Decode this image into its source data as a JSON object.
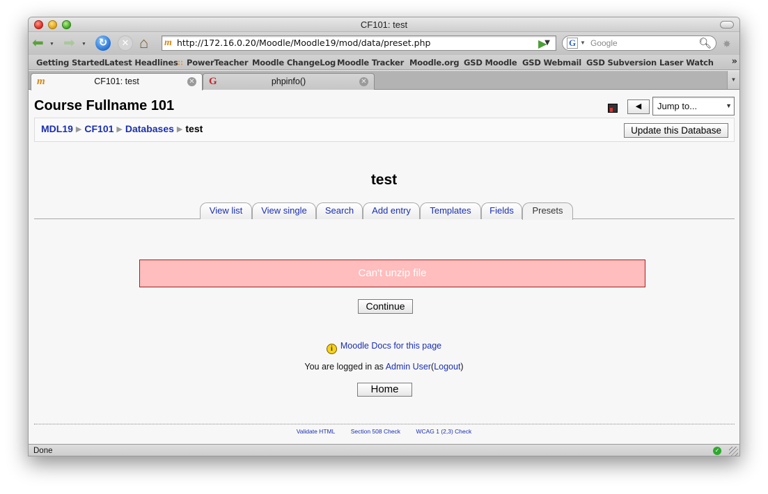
{
  "window": {
    "title": "CF101: test"
  },
  "toolbar": {
    "url": "http://172.16.0.20/Moodle/Moodle19/mod/data/preset.php",
    "search_placeholder": "Google"
  },
  "bookmarks": [
    {
      "label": "Getting Started"
    },
    {
      "label": "Latest Headlines"
    },
    {
      "label": "PowerTeacher"
    },
    {
      "label": "Moodle ChangeLog"
    },
    {
      "label": "Moodle Tracker"
    },
    {
      "label": "Moodle.org"
    },
    {
      "label": "GSD Moodle"
    },
    {
      "label": "GSD Webmail"
    },
    {
      "label": "GSD Subversion"
    },
    {
      "label": "Laser Watch"
    }
  ],
  "browser_tabs": [
    {
      "title": "CF101: test",
      "icon": "moodle-icon"
    },
    {
      "title": "phpinfo()",
      "icon": "google-icon"
    }
  ],
  "page": {
    "course_title": "Course Fullname 101",
    "jump_label": "Jump to...",
    "breadcrumbs": [
      "MDL19",
      "CF101",
      "Databases",
      "test"
    ],
    "update_button": "Update this Database",
    "heading": "test",
    "tabs": [
      "View list",
      "View single",
      "Search",
      "Add entry",
      "Templates",
      "Fields",
      "Presets"
    ],
    "selected_tab": "Presets",
    "error_message": "Can't unzip file",
    "continue_label": "Continue",
    "docs_link": "Moodle Docs for this page",
    "logged_in_prefix": "You are logged in as",
    "user_name": "Admin User",
    "logout_label": "Logout",
    "home_label": "Home",
    "footer_links": [
      "Validate HTML",
      "Section 508 Check",
      "WCAG 1 (2,3) Check"
    ]
  },
  "status": {
    "text": "Done"
  },
  "colors": {
    "error_bg": "#ffbdbd",
    "error_border": "#a01f1f",
    "link": "#1a2fb0"
  }
}
